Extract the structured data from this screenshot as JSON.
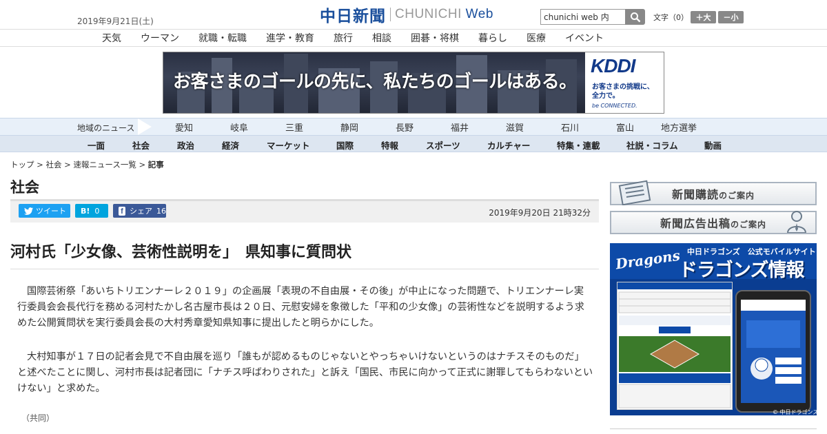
{
  "header": {
    "date": "2019年9月21日(土)",
    "logo_jp": "中日新聞",
    "logo_en_a": "CHUNICHI ",
    "logo_en_b": "Web",
    "search_value": "chunichi web 内",
    "fontsize_label": "文字（0）",
    "font_bigger": "＋大",
    "font_smaller": "－小"
  },
  "category_nav": [
    "天気",
    "ウーマン",
    "就職・転職",
    "進学・教育",
    "旅行",
    "相談",
    "囲碁・将棋",
    "暮らし",
    "医療",
    "イベント"
  ],
  "ad": {
    "copy": "お客さまのゴールの先に、私たちのゴールはある。",
    "brand": "KDDI",
    "tagline_1": "お客さまの挑戦に、",
    "tagline_2": "全力で。",
    "be_connected": "be CONNECTED."
  },
  "region_nav": {
    "label": "地域のニュース",
    "items": [
      "愛知",
      "岐阜",
      "三重",
      "静岡",
      "長野",
      "福井",
      "滋賀",
      "石川",
      "富山",
      "地方選挙"
    ]
  },
  "main_nav": [
    "一面",
    "社会",
    "政治",
    "経済",
    "マーケット",
    "国際",
    "特報",
    "スポーツ",
    "カルチャー",
    "特集・連載",
    "社説・コラム",
    "動画"
  ],
  "breadcrumb": {
    "items": [
      "トップ",
      "社会",
      "速報ニュース一覧"
    ],
    "sep": " > ",
    "current": "記事"
  },
  "section_title": "社会",
  "share": {
    "tweet": "ツイート",
    "hatena": "B!",
    "hatena_count": "0",
    "facebook": "シェア",
    "facebook_count": "16",
    "published": "2019年9月20日 21時32分"
  },
  "article": {
    "headline": "河村氏「少女像、芸術性説明を」　県知事に質問状",
    "paragraphs": [
      "国際芸術祭「あいちトリエンナーレ２０１９」の企画展「表現の不自由展・その後」が中止になった問題で、トリエンナーレ実行委員会会長代行を務める河村たかし名古屋市長は２０日、元慰安婦を象徴した「平和の少女像」の芸術性などを説明するよう求めた公開質問状を実行委員会長の大村秀章愛知県知事に提出したと明らかにした。",
      "大村知事が１７日の記者会見で不自由展を巡り「誰もが認めるものじゃないとやっちゃいけないというのはナチスそのものだ」と述べたことに関し、河村市長は記者団に「ナチス呼ばわりされた」と訴え「国民、市民に向かって正式に謝罪してもらわないといけない」と求めた。"
    ],
    "credit": "（共同）"
  },
  "sidebar": {
    "subscribe_main": "新聞購読",
    "subscribe_sub": "のご案内",
    "ad_main": "新聞広告出稿",
    "ad_sub": "のご案内",
    "dragons_logo": "Dragons",
    "dragons_sub": "中日ドラゴンズ　公式モバイルサイト",
    "dragons_big": "ドラゴンズ情報",
    "dragons_copyright": "© 中日ドラゴンズ"
  },
  "colors": {
    "brand_blue": "#1a4f9c",
    "twitter": "#1da1f2",
    "hatena": "#00a4de",
    "facebook": "#3b5998",
    "region_bg": "#e8f0f9",
    "mainnav_bg": "#dde6f1"
  }
}
